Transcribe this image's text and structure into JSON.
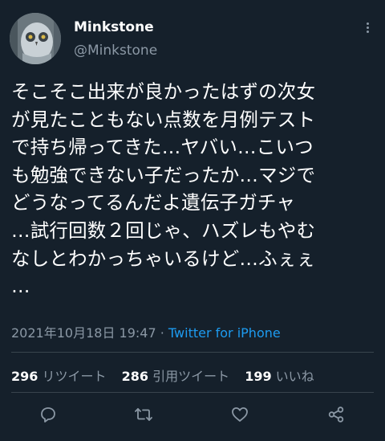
{
  "user": {
    "display_name": "Minkstone",
    "handle": "@Minkstone"
  },
  "tweet": {
    "text": "そこそこ出来が良かったはずの次女\nが見たこともない点数を月例テスト\nで持ち帰ってきた…ヤバい…こいつ\nも勉強できない子だったか…マジで\nどうなってるんだよ遺伝子ガチャ\n…試行回数２回じゃ、ハズレもやむ\nなしとわかっちゃいるけど…ふぇぇ\n…",
    "timestamp": "2021年10月18日 19:47",
    "separator": " · ",
    "source": "Twitter for iPhone"
  },
  "stats": {
    "retweets_count": "296",
    "retweets_label": " リツイート",
    "quotes_count": "286",
    "quotes_label": " 引用ツイート",
    "likes_count": "199",
    "likes_label": " いいね"
  },
  "icons": {
    "more": "more-icon",
    "reply": "reply-icon",
    "retweet": "retweet-icon",
    "like": "like-icon",
    "share": "share-icon"
  },
  "colors": {
    "background": "#15202b",
    "text": "#ffffff",
    "muted": "#8b98a5",
    "link": "#1d9bf0",
    "divider": "#38444d"
  }
}
